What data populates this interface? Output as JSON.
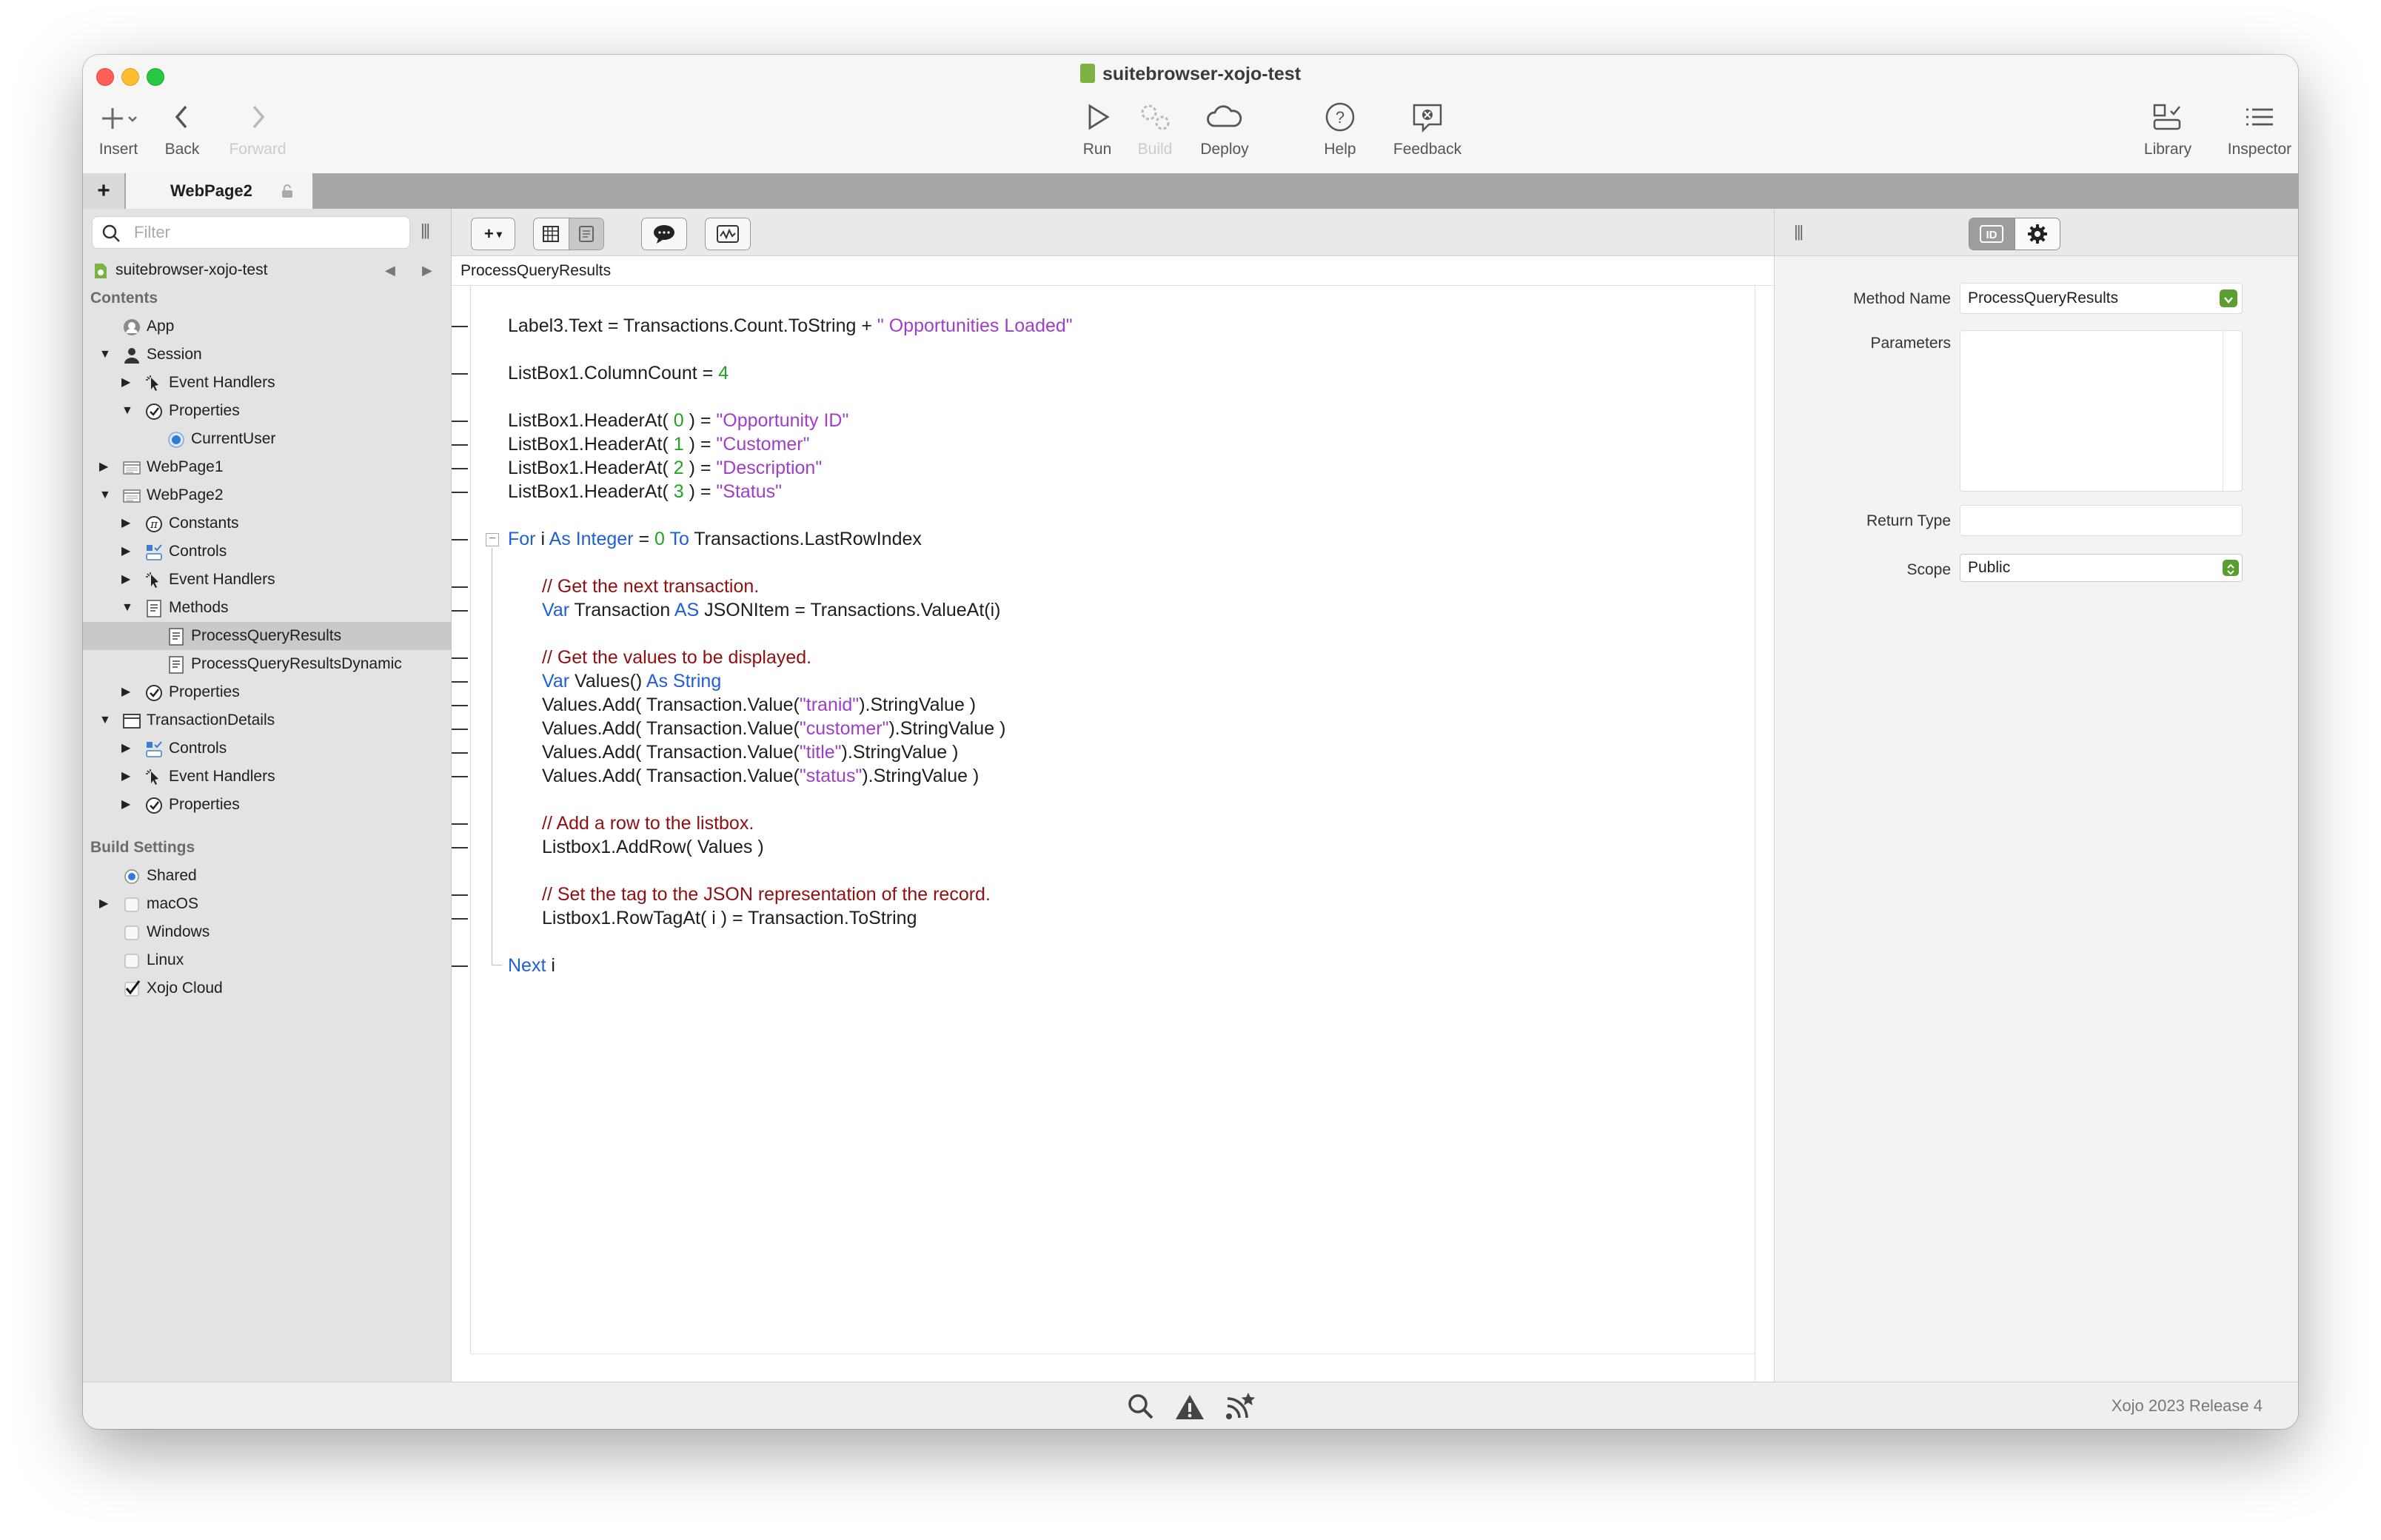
{
  "window": {
    "title": "suitebrowser-xojo-test"
  },
  "toolbar": {
    "insert": "Insert",
    "back": "Back",
    "forward": "Forward",
    "run": "Run",
    "build": "Build",
    "deploy": "Deploy",
    "help": "Help",
    "feedback": "Feedback",
    "library": "Library",
    "inspector": "Inspector"
  },
  "tabs": {
    "add": "+",
    "active": "WebPage2"
  },
  "navigator": {
    "filter_placeholder": "Filter",
    "project": "suitebrowser-xojo-test",
    "contents_header": "Contents",
    "items": [
      "App",
      "Session",
      "Event Handlers",
      "Properties",
      "CurrentUser",
      "WebPage1",
      "WebPage2",
      "Constants",
      "Controls",
      "Event Handlers",
      "Methods",
      "ProcessQueryResults",
      "ProcessQueryResultsDynamic",
      "Properties",
      "TransactionDetails",
      "Controls",
      "Event Handlers",
      "Properties"
    ],
    "build_header": "Build Settings",
    "build_items": [
      "Shared",
      "macOS",
      "Windows",
      "Linux",
      "Xojo Cloud"
    ]
  },
  "editor": {
    "toolbar_add": "+",
    "path": "ProcessQueryResults",
    "code": [
      [
        {
          "t": "Label3.Text = Transactions.Count.ToString + "
        },
        {
          "t": "\" Opportunities Loaded\"",
          "c": "str"
        }
      ],
      [
        {
          "t": "ListBox1.ColumnCount = "
        },
        {
          "t": "4",
          "c": "num"
        }
      ],
      [
        {
          "t": "ListBox1.HeaderAt( "
        },
        {
          "t": "0",
          "c": "num"
        },
        {
          "t": " ) = "
        },
        {
          "t": "\"Opportunity ID\"",
          "c": "str"
        }
      ],
      [
        {
          "t": "ListBox1.HeaderAt( "
        },
        {
          "t": "1",
          "c": "num"
        },
        {
          "t": " ) = "
        },
        {
          "t": "\"Customer\"",
          "c": "str"
        }
      ],
      [
        {
          "t": "ListBox1.HeaderAt( "
        },
        {
          "t": "2",
          "c": "num"
        },
        {
          "t": " ) = "
        },
        {
          "t": "\"Description\"",
          "c": "str"
        }
      ],
      [
        {
          "t": "ListBox1.HeaderAt( "
        },
        {
          "t": "3",
          "c": "num"
        },
        {
          "t": " ) = "
        },
        {
          "t": "\"Status\"",
          "c": "str"
        }
      ],
      [
        {
          "t": "For",
          "c": "kw"
        },
        {
          "t": " i "
        },
        {
          "t": "As Integer",
          "c": "kw"
        },
        {
          "t": " = "
        },
        {
          "t": "0",
          "c": "num"
        },
        {
          "t": " "
        },
        {
          "t": "To",
          "c": "kw"
        },
        {
          "t": " Transactions.LastRowIndex"
        }
      ],
      [
        {
          "t": "// Get the next transaction.",
          "c": "cm"
        }
      ],
      [
        {
          "t": "Var",
          "c": "kw"
        },
        {
          "t": " Transaction "
        },
        {
          "t": "AS",
          "c": "kw"
        },
        {
          "t": " JSONItem = Transactions.ValueAt(i)"
        }
      ],
      [
        {
          "t": "// Get the values to be displayed.",
          "c": "cm"
        }
      ],
      [
        {
          "t": "Var",
          "c": "kw"
        },
        {
          "t": " Values() "
        },
        {
          "t": "As String",
          "c": "kw"
        }
      ],
      [
        {
          "t": "Values.Add( Transaction.Value("
        },
        {
          "t": "\"tranid\"",
          "c": "str"
        },
        {
          "t": ").StringValue )"
        }
      ],
      [
        {
          "t": "Values.Add( Transaction.Value("
        },
        {
          "t": "\"customer\"",
          "c": "str"
        },
        {
          "t": ").StringValue )"
        }
      ],
      [
        {
          "t": "Values.Add( Transaction.Value("
        },
        {
          "t": "\"title\"",
          "c": "str"
        },
        {
          "t": ").StringValue )"
        }
      ],
      [
        {
          "t": "Values.Add( Transaction.Value("
        },
        {
          "t": "\"status\"",
          "c": "str"
        },
        {
          "t": ").StringValue )"
        }
      ],
      [
        {
          "t": "// Add a row to the listbox.",
          "c": "cm"
        }
      ],
      [
        {
          "t": "Listbox1.AddRow( Values )"
        }
      ],
      [
        {
          "t": "// Set the tag to the JSON representation of the record.",
          "c": "cm"
        }
      ],
      [
        {
          "t": "Listbox1.RowTagAt( i ) = Transaction.ToString"
        }
      ],
      [
        {
          "t": "Next",
          "c": "kw"
        },
        {
          "t": " i"
        }
      ]
    ]
  },
  "inspector": {
    "method_name_label": "Method Name",
    "method_name": "ProcessQueryResults",
    "parameters_label": "Parameters",
    "parameters": "",
    "return_type_label": "Return Type",
    "return_type": "",
    "scope_label": "Scope",
    "scope": "Public"
  },
  "status": {
    "version": "Xojo 2023 Release 4"
  }
}
